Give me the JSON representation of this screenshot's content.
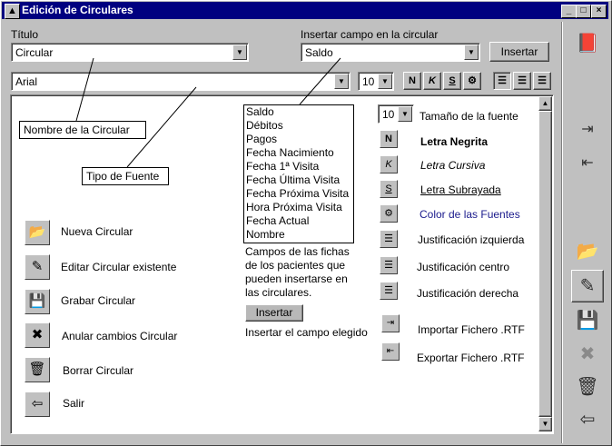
{
  "window": {
    "title": "Edición de Circulares"
  },
  "form": {
    "titulo_label": "Título",
    "titulo_value": "Circular",
    "insertar_campo_label": "Insertar campo en la circular",
    "insertar_campo_value": "Saldo",
    "insertar_button": "Insertar",
    "font_value": "Arial",
    "size_value": "10"
  },
  "toolbar": {
    "bold": "N",
    "italic": "K",
    "underline": "S"
  },
  "callouts": {
    "nombre": "Nombre de la Circular",
    "tipo": "Tipo de Fuente"
  },
  "fields_list": [
    "Saldo",
    "Débitos",
    "Pagos",
    "Fecha Nacimiento",
    "Fecha 1ª Visita",
    "Fecha Última Visita",
    "Fecha Próxima Visita",
    "Hora Próxima Visita",
    "Fecha Actual",
    "Nombre"
  ],
  "fields_help": [
    "Campos de las fichas",
    "de los pacientes que",
    "pueden insertarse en",
    "las circulares."
  ],
  "insert_help_button": "Insertar",
  "insert_help_text": "Insertar el campo elegido",
  "help_actions": [
    {
      "icon": "open-folder-icon",
      "label": "Nueva Circular"
    },
    {
      "icon": "edit-document-icon",
      "label": "Editar Circular existente"
    },
    {
      "icon": "save-disk-icon",
      "label": "Grabar Circular"
    },
    {
      "icon": "cancel-changes-icon",
      "label": "Anular cambios Circular"
    },
    {
      "icon": "trash-icon",
      "label": "Borrar Circular"
    },
    {
      "icon": "exit-door-icon",
      "label": "Salir"
    }
  ],
  "format_help": {
    "size_value": "10",
    "size_label": "Tamaño de la fuente",
    "bold_label": "Letra Negrita",
    "italic_label": "Letra Cursiva",
    "underline_label": "Letra Subrayada",
    "color_label": "Color de las Fuentes",
    "left_label": "Justificación izquierda",
    "center_label": "Justificación centro",
    "right_label": "Justificación derecha",
    "import_label": "Importar Fichero .RTF",
    "export_label": "Exportar Fichero .RTF"
  },
  "colors": {
    "titlebar": "#000080",
    "link_color": "#1a1a8c",
    "book": "#a0208c"
  }
}
